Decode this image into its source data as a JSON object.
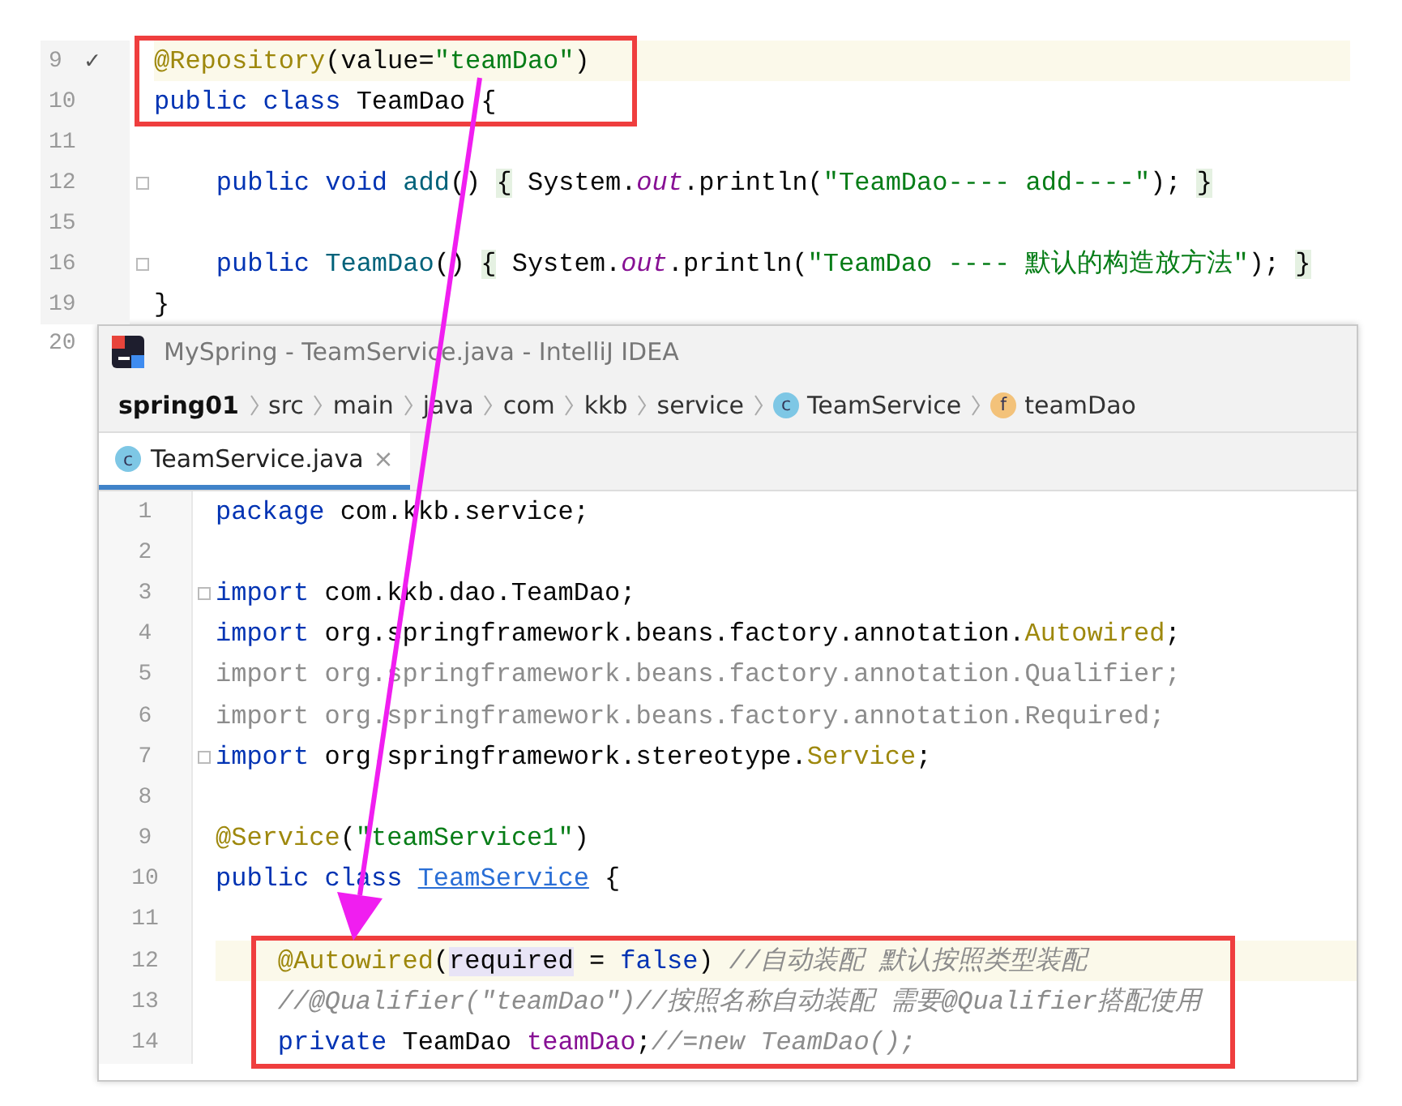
{
  "background_editor": {
    "lines": [
      {
        "number": "9",
        "marker": "✓",
        "current": true,
        "framed": true,
        "fold": false,
        "tokens": [
          {
            "text": "@Repository",
            "kind": "annotation"
          },
          {
            "text": "(value=",
            "kind": "plain"
          },
          {
            "text": "\"teamDao\"",
            "kind": "string"
          },
          {
            "text": ")",
            "kind": "plain"
          }
        ]
      },
      {
        "number": "10",
        "current": false,
        "framed": true,
        "fold": false,
        "tokens": [
          {
            "text": "public class",
            "kind": "keyword"
          },
          {
            "text": " TeamDao {",
            "kind": "plain"
          }
        ]
      },
      {
        "number": "11",
        "current": false,
        "framed": false,
        "fold": false
      },
      {
        "number": "12",
        "current": false,
        "framed": false,
        "fold": true,
        "tokens": [
          {
            "text": "    public void",
            "kind": "keyword"
          },
          {
            "text": " add",
            "kind": "method"
          },
          {
            "text": "() ",
            "kind": "plain"
          },
          {
            "text": "{",
            "kind": "folded"
          },
          {
            "text": " System.",
            "kind": "plain"
          },
          {
            "text": "out",
            "kind": "static"
          },
          {
            "text": ".println(",
            "kind": "plain"
          },
          {
            "text": "\"TeamDao---- add----\"",
            "kind": "string"
          },
          {
            "text": "); ",
            "kind": "plain"
          },
          {
            "text": "}",
            "kind": "folded"
          }
        ]
      },
      {
        "number": "15",
        "current": false,
        "framed": false,
        "fold": false
      },
      {
        "number": "16",
        "current": false,
        "framed": false,
        "fold": true,
        "tokens": [
          {
            "text": "    public",
            "kind": "keyword"
          },
          {
            "text": " TeamDao",
            "kind": "method"
          },
          {
            "text": "() ",
            "kind": "plain"
          },
          {
            "text": "{",
            "kind": "folded"
          },
          {
            "text": " System.",
            "kind": "plain"
          },
          {
            "text": "out",
            "kind": "static"
          },
          {
            "text": ".println(",
            "kind": "plain"
          },
          {
            "text": "\"TeamDao ---- 默认的构造放方法\"",
            "kind": "string"
          },
          {
            "text": "); ",
            "kind": "plain"
          },
          {
            "text": "}",
            "kind": "folded"
          }
        ]
      },
      {
        "number": "19",
        "current": false,
        "framed": false,
        "fold": false,
        "tokens": [
          {
            "text": "}",
            "kind": "plain"
          }
        ]
      }
    ],
    "hidden_line_number": "20"
  },
  "window": {
    "title": "MySpring - TeamService.java - IntelliJ IDEA",
    "breadcrumbs": [
      {
        "label": "spring01",
        "kind": "project"
      },
      {
        "label": "src",
        "kind": "folder"
      },
      {
        "label": "main",
        "kind": "folder"
      },
      {
        "label": "java",
        "kind": "folder"
      },
      {
        "label": "com",
        "kind": "folder"
      },
      {
        "label": "kkb",
        "kind": "folder"
      },
      {
        "label": "service",
        "kind": "folder"
      },
      {
        "label": "TeamService",
        "kind": "class",
        "badge": "c"
      },
      {
        "label": "teamDao",
        "kind": "field",
        "badge": "f"
      }
    ],
    "tabs": [
      {
        "label": "TeamService.java",
        "badge": "c",
        "close": "×",
        "selected": true
      }
    ],
    "editor": {
      "lines": [
        {
          "number": "1",
          "current": false,
          "framed": false,
          "fold": false,
          "tokens": [
            {
              "text": "package",
              "kind": "keyword"
            },
            {
              "text": " com.kkb.service;",
              "kind": "plain"
            }
          ]
        },
        {
          "number": "2",
          "current": false,
          "framed": false,
          "fold": false
        },
        {
          "number": "3",
          "current": false,
          "framed": false,
          "fold": true,
          "tokens": [
            {
              "text": "import",
              "kind": "keyword"
            },
            {
              "text": " com.kkb.dao.TeamDao;",
              "kind": "plain"
            }
          ]
        },
        {
          "number": "4",
          "current": false,
          "framed": false,
          "fold": false,
          "tokens": [
            {
              "text": "import",
              "kind": "keyword"
            },
            {
              "text": " org.springframework.beans.factory.annotation.",
              "kind": "plain"
            },
            {
              "text": "Autowired",
              "kind": "annotation"
            },
            {
              "text": ";",
              "kind": "plain"
            }
          ]
        },
        {
          "number": "5",
          "current": false,
          "framed": false,
          "fold": false,
          "tokens": [
            {
              "text": "import org.springframework.beans.factory.annotation.Qualifier;",
              "kind": "unused"
            }
          ]
        },
        {
          "number": "6",
          "current": false,
          "framed": false,
          "fold": false,
          "tokens": [
            {
              "text": "import org.springframework.beans.factory.annotation.Required;",
              "kind": "unused"
            }
          ]
        },
        {
          "number": "7",
          "current": false,
          "framed": false,
          "fold": true,
          "tokens": [
            {
              "text": "import",
              "kind": "keyword"
            },
            {
              "text": " org.springframework.stereotype.",
              "kind": "plain"
            },
            {
              "text": "Service",
              "kind": "annotation"
            },
            {
              "text": ";",
              "kind": "plain"
            }
          ]
        },
        {
          "number": "8",
          "current": false,
          "framed": false,
          "fold": false
        },
        {
          "number": "9",
          "current": false,
          "framed": false,
          "fold": false,
          "tokens": [
            {
              "text": "@Service",
              "kind": "annotation"
            },
            {
              "text": "(",
              "kind": "plain"
            },
            {
              "text": "\"teamService1\"",
              "kind": "string"
            },
            {
              "text": ")",
              "kind": "plain"
            }
          ]
        },
        {
          "number": "10",
          "current": false,
          "framed": false,
          "fold": false,
          "tokens": [
            {
              "text": "public class ",
              "kind": "keyword"
            },
            {
              "text": "TeamService",
              "kind": "link"
            },
            {
              "text": " {",
              "kind": "plain"
            }
          ]
        },
        {
          "number": "11",
          "current": false,
          "framed": false,
          "fold": false
        },
        {
          "number": "12",
          "current": true,
          "framed": true,
          "fold": false,
          "tokens": [
            {
              "text": "    @Autowired",
              "kind": "annotation"
            },
            {
              "text": "(",
              "kind": "plain"
            },
            {
              "text": "required",
              "kind": "param"
            },
            {
              "text": " = ",
              "kind": "plain"
            },
            {
              "text": "false",
              "kind": "keyword"
            },
            {
              "text": ") ",
              "kind": "plain"
            },
            {
              "text": "//自动装配 默认按照类型装配",
              "kind": "comment"
            }
          ]
        },
        {
          "number": "13",
          "current": false,
          "framed": true,
          "fold": false,
          "tokens": [
            {
              "text": "    //@Qualifier(\"teamDao\")//按照名称自动装配 需要@Qualifier搭配使用",
              "kind": "comment"
            }
          ]
        },
        {
          "number": "14",
          "current": false,
          "framed": true,
          "fold": false,
          "tokens": [
            {
              "text": "    private",
              "kind": "keyword"
            },
            {
              "text": " TeamDao ",
              "kind": "plain"
            },
            {
              "text": "teamDao",
              "kind": "field"
            },
            {
              "text": ";",
              "kind": "plain"
            },
            {
              "text": "//=new TeamDao();",
              "kind": "comment"
            }
          ]
        }
      ]
    }
  }
}
